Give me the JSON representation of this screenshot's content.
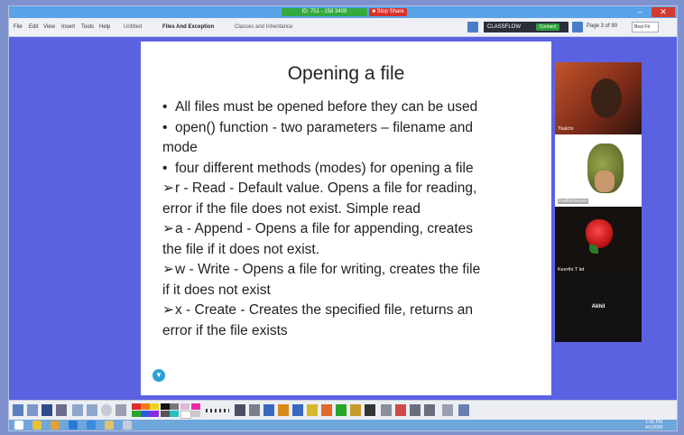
{
  "titlebar": {
    "share_info": "ID: 751 - 158 3409",
    "stop_share": "■ Stop Share",
    "minimize": "–",
    "restore": "▫",
    "close": "✕"
  },
  "menubar": {
    "items": [
      "File",
      "Edit",
      "View",
      "Insert",
      "Tools",
      "Help"
    ],
    "tabs": [
      "Untitled",
      "Files And Exception",
      "Classes and Inheritance"
    ],
    "brand": "CLASSFLOW",
    "connect": "Connect",
    "page_indicator": "Page 3 of 90",
    "zoom": "Best Fit"
  },
  "slide": {
    "title": "Opening a file",
    "lines": [
      {
        "marker": "•",
        "text": "All files must be opened before they can be used"
      },
      {
        "marker": "•",
        "text": "open() function - two parameters – filename and"
      },
      {
        "marker": "",
        "text": "mode"
      },
      {
        "marker": "•",
        "text": "four different methods (modes) for opening a file"
      },
      {
        "marker": "➢",
        "text": "r - Read - Default value. Opens a file for reading,"
      },
      {
        "marker": "",
        "text": "error if the file does not exist. Simple read"
      },
      {
        "marker": "➢",
        "text": "a - Append - Opens a file for appending, creates"
      },
      {
        "marker": "",
        "text": "the file if it does not exist."
      },
      {
        "marker": "➢",
        "text": "w - Write - Opens a file for writing, creates the file"
      },
      {
        "marker": "",
        "text": "if it does not exist"
      },
      {
        "marker": "➢",
        "text": "x - Create - Creates the specified file, returns an"
      },
      {
        "marker": "",
        "text": "error if the file exists"
      }
    ]
  },
  "participants": [
    {
      "name": "Tkalchi"
    },
    {
      "name": "Karthickeyan"
    },
    {
      "name": "Keerthi T let"
    },
    {
      "name": "Akhil"
    }
  ],
  "taskbar": {
    "time": "1:01 PM",
    "date": "4/1/2020"
  }
}
